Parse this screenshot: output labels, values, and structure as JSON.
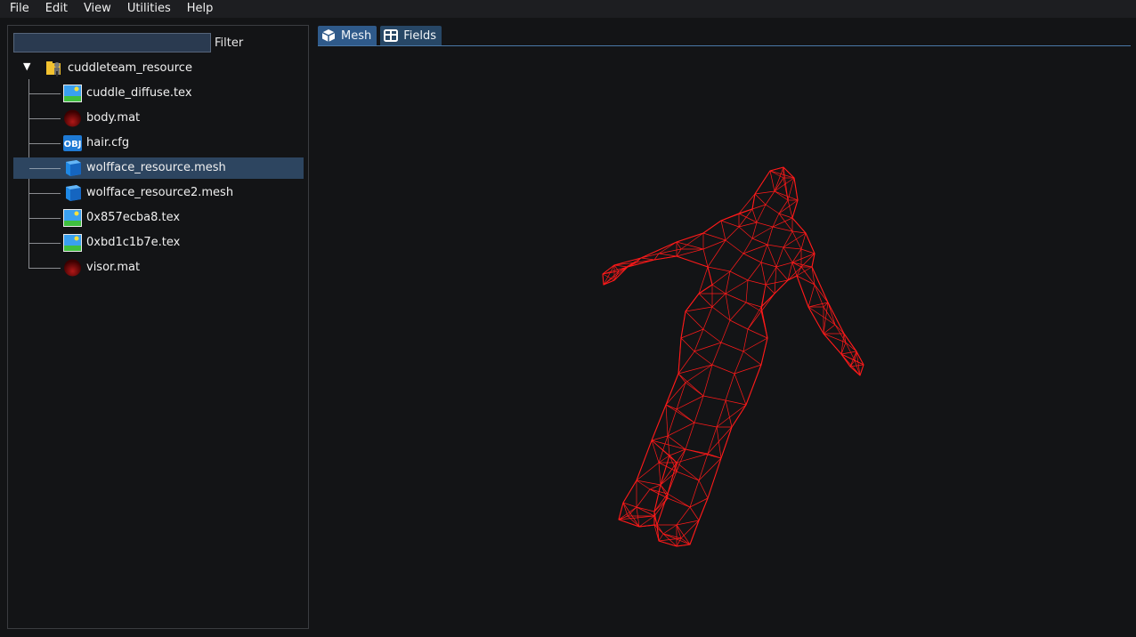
{
  "menubar": {
    "items": [
      "File",
      "Edit",
      "View",
      "Utilities",
      "Help"
    ]
  },
  "filter": {
    "value": "",
    "placeholder": "",
    "label": "Filter"
  },
  "tree": {
    "root": {
      "label": "cuddleteam_resource",
      "expanded": true,
      "icon": "package-folder-icon"
    },
    "items": [
      {
        "label": "cuddle_diffuse.tex",
        "icon": "image-icon"
      },
      {
        "label": "body.mat",
        "icon": "material-sphere-icon"
      },
      {
        "label": "hair.cfg",
        "icon": "obj-icon",
        "icon_text": "OBJ"
      },
      {
        "label": "wolfface_resource.mesh",
        "icon": "mesh-cube-icon",
        "selected": true
      },
      {
        "label": "wolfface_resource2.mesh",
        "icon": "mesh-cube-icon"
      },
      {
        "label": "0x857ecba8.tex",
        "icon": "image-icon"
      },
      {
        "label": "0xbd1c1b7e.tex",
        "icon": "image-icon"
      },
      {
        "label": "visor.mat",
        "icon": "material-sphere-icon"
      }
    ]
  },
  "tabs": [
    {
      "label": "Mesh",
      "icon": "cube-icon",
      "active": true
    },
    {
      "label": "Fields",
      "icon": "table-icon",
      "active": false
    }
  ],
  "viewport": {
    "wireframe_color": "#ff1a1a",
    "background": "#131416"
  },
  "colors": {
    "selection": "#2d4560",
    "tab_active": "#2f5a8a",
    "accent_line": "#4a78a8"
  }
}
